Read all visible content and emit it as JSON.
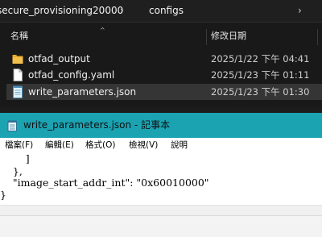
{
  "explorer": {
    "breadcrumb": [
      "secure_provisioning20000",
      "configs"
    ],
    "columns": {
      "name": "名稱",
      "date": "修改日期"
    },
    "rows": [
      {
        "icon": "folder-icon",
        "name": "otfad_output",
        "date": "2025/1/22 下午 04:41",
        "selected": false
      },
      {
        "icon": "file-icon",
        "name": "otfad_config.yaml",
        "date": "2025/1/23 下午 01:11",
        "selected": false
      },
      {
        "icon": "notepad-file-icon",
        "name": "write_parameters.json",
        "date": "2025/1/23 下午 01:30",
        "selected": true
      }
    ]
  },
  "notepad": {
    "title": "write_parameters.json - 記事本",
    "menu": [
      "檔案(F)",
      "編輯(E)",
      "格式(O)",
      "檢視(V)",
      "說明"
    ],
    "lines": [
      "        ]",
      "    },",
      "    \"image_start_addr_int\": \"0x60010000\"",
      "}"
    ]
  },
  "colors": {
    "explorer_bg": "#191919",
    "selection": "#353535",
    "notepad_titlebar": "#1ba3b2",
    "folder": "#f3c14b"
  }
}
